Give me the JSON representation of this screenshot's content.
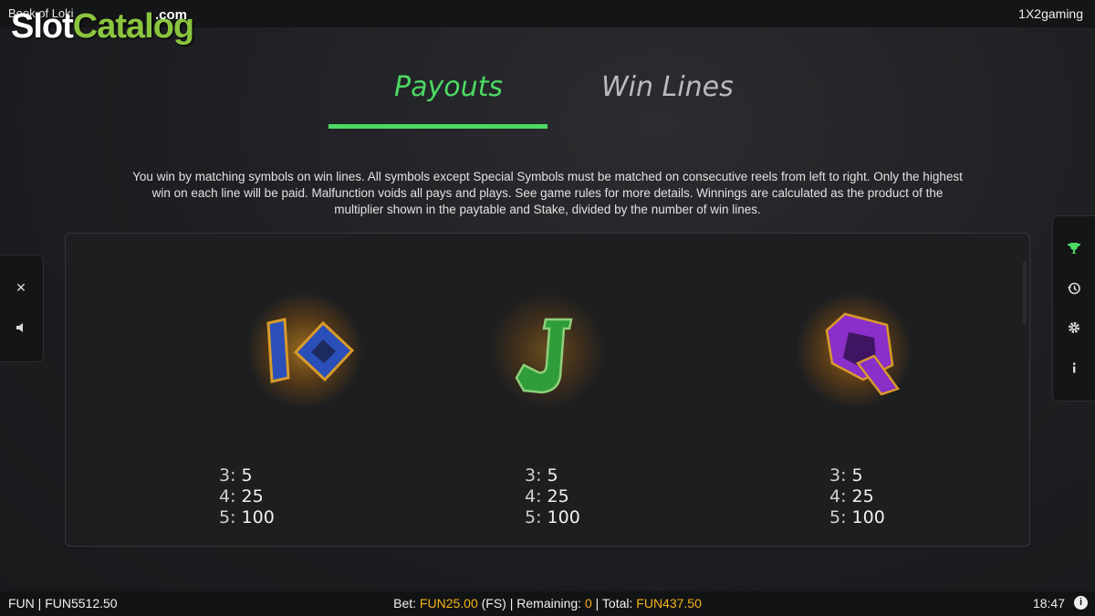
{
  "header": {
    "game_title": "Book of Loki",
    "brand": "1X2gaming"
  },
  "watermark": {
    "part1": "Slot",
    "part2": "Catalog",
    "suffix": ".com"
  },
  "tabs": [
    {
      "label": "Payouts",
      "active": true
    },
    {
      "label": "Win Lines",
      "active": false
    }
  ],
  "description": "You win by matching symbols on win lines. All symbols except Special Symbols must be matched on consecutive reels from left to right. Only the highest win on each line will be paid. Malfunction voids all pays and plays. See game rules for more details. Winnings are calculated as the product of the multiplier shown in the paytable and Stake, divided by the number of win lines.",
  "symbols": [
    {
      "name": "10",
      "icon": "ten-symbol-icon",
      "color": "#2b4fb8",
      "pays": [
        {
          "k": "3:",
          "v": "5"
        },
        {
          "k": "4:",
          "v": "25"
        },
        {
          "k": "5:",
          "v": "100"
        }
      ]
    },
    {
      "name": "J",
      "icon": "jack-symbol-icon",
      "color": "#2f9e3a",
      "pays": [
        {
          "k": "3:",
          "v": "5"
        },
        {
          "k": "4:",
          "v": "25"
        },
        {
          "k": "5:",
          "v": "100"
        }
      ]
    },
    {
      "name": "Q",
      "icon": "queen-symbol-icon",
      "color": "#8a2fc7",
      "pays": [
        {
          "k": "3:",
          "v": "5"
        },
        {
          "k": "4:",
          "v": "25"
        },
        {
          "k": "5:",
          "v": "100"
        }
      ]
    }
  ],
  "left_sidebar": [
    {
      "icon": "close-icon",
      "glyph": "✕"
    },
    {
      "icon": "sound-icon",
      "glyph": "◀"
    }
  ],
  "right_sidebar": [
    {
      "icon": "trophy-icon"
    },
    {
      "icon": "history-icon"
    },
    {
      "icon": "settings-gear-icon"
    },
    {
      "icon": "info-icon"
    }
  ],
  "footer": {
    "balance": "FUN | FUN5512.50",
    "bet_label": "Bet: ",
    "bet_value": "FUN25.00",
    "fs": " (FS) | Remaining: ",
    "remaining": "0",
    "total_label": " | Total: ",
    "total_value": "FUN437.50",
    "time": "18:47",
    "info_glyph": "i"
  },
  "colors": {
    "accent": "#4cd964",
    "amber": "#f5b317"
  }
}
